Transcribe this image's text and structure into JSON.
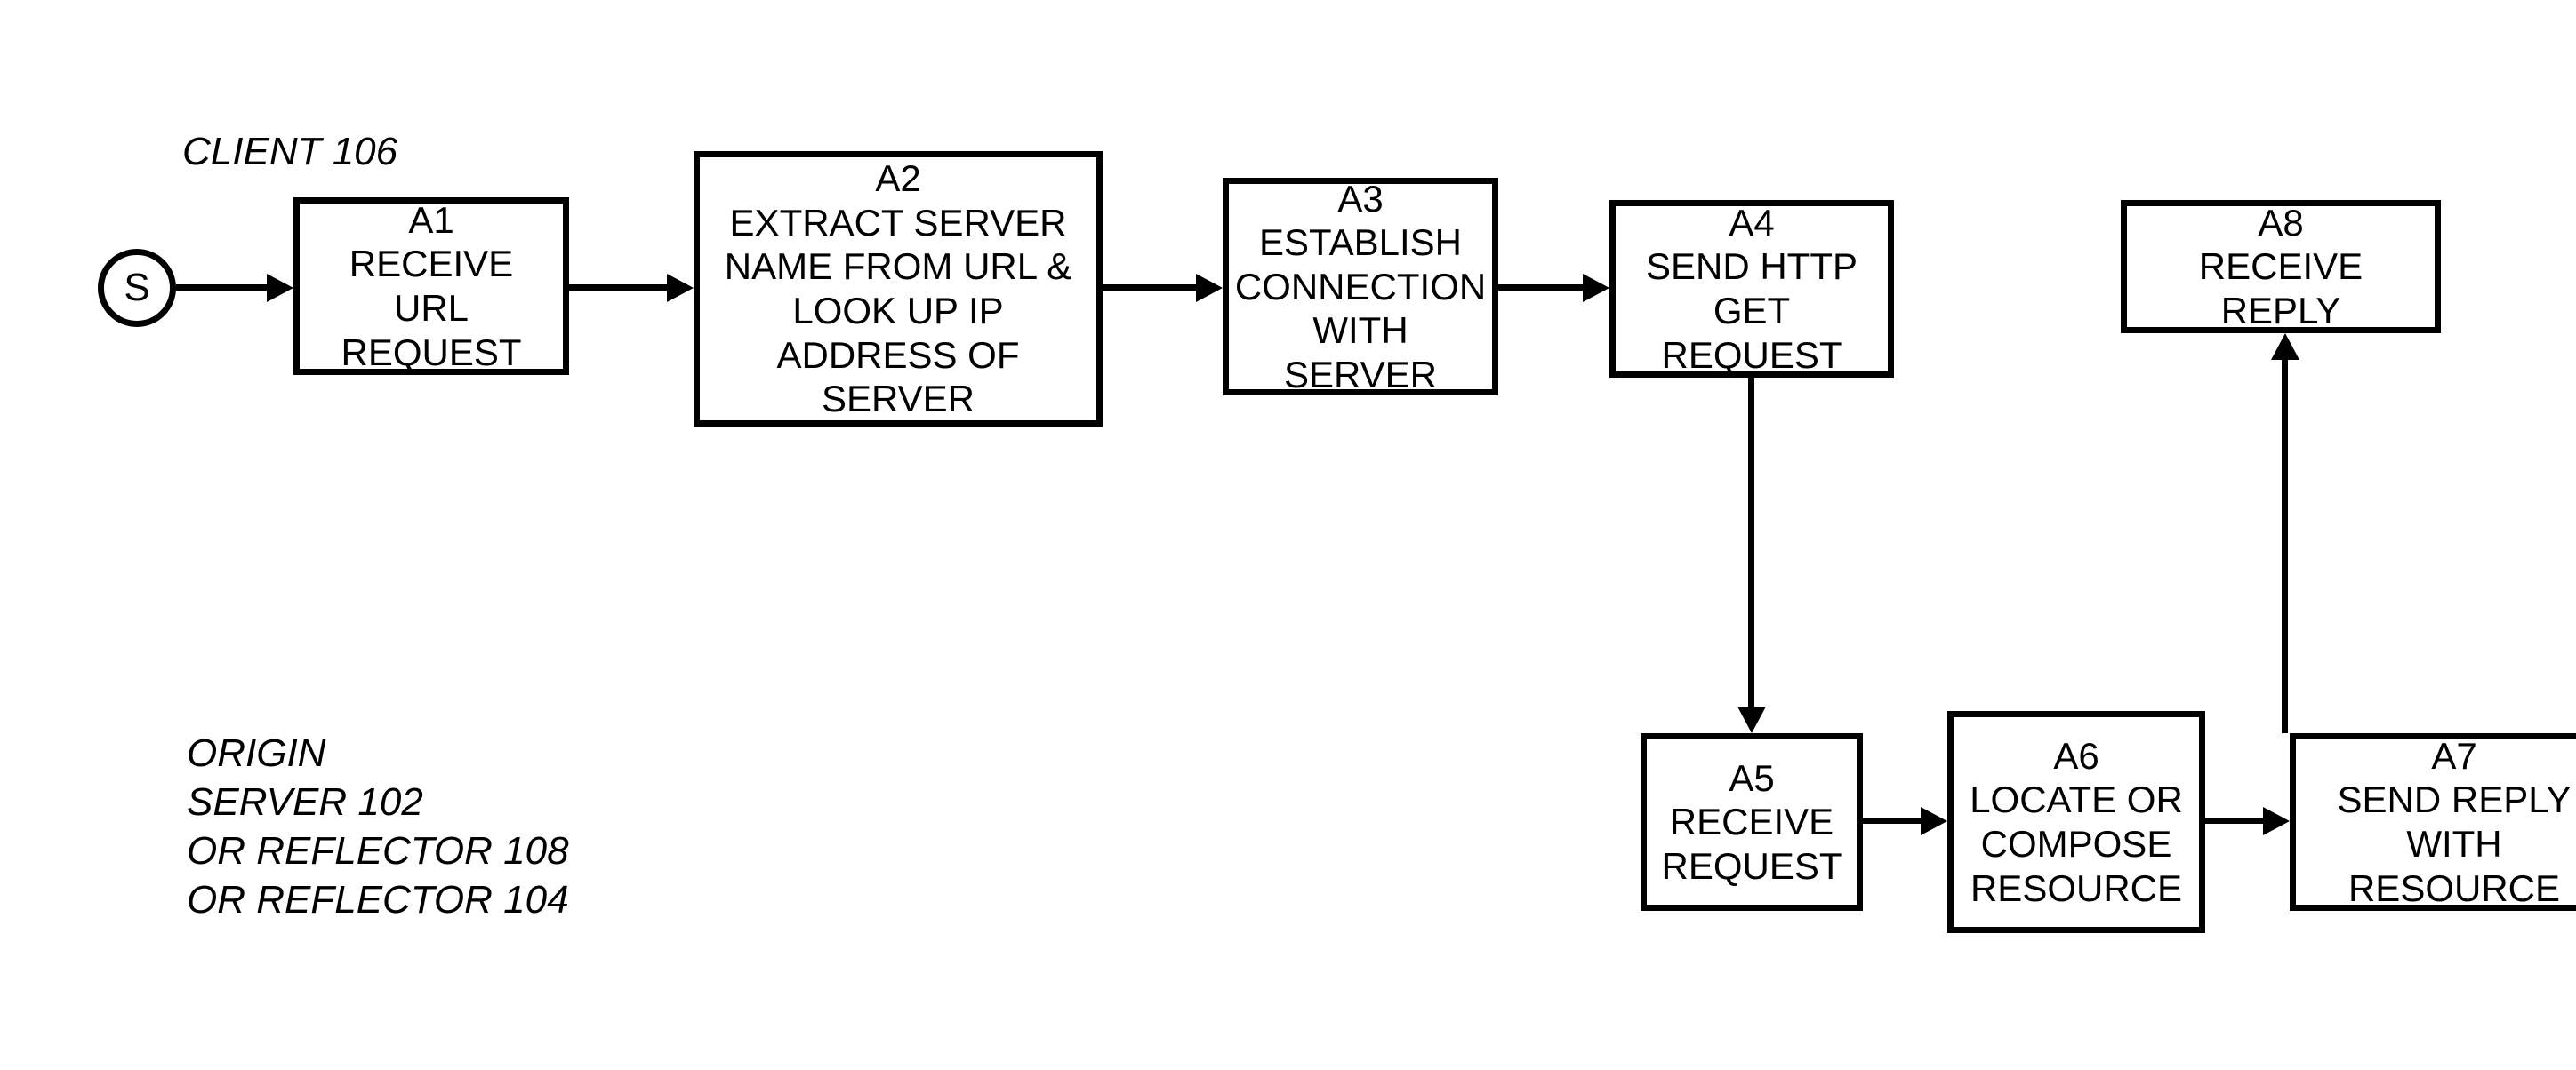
{
  "labels": {
    "client": "CLIENT 106",
    "origin_line1": "ORIGIN",
    "origin_line2": "SERVER 102",
    "origin_line3": "OR REFLECTOR 108",
    "origin_line4": "OR REFLECTOR 104"
  },
  "start": "S",
  "boxes": {
    "a1_code": "A1",
    "a1_text": "RECEIVE URL REQUEST",
    "a2_code": "A2",
    "a2_text": "EXTRACT SERVER NAME FROM URL & LOOK UP IP ADDRESS OF SERVER",
    "a3_code": "A3",
    "a3_text": "ESTABLISH CONNECTION WITH SERVER",
    "a4_code": "A4",
    "a4_text": "SEND HTTP GET REQUEST",
    "a5_code": "A5",
    "a5_text": "RECEIVE REQUEST",
    "a6_code": "A6",
    "a6_text": "LOCATE OR COMPOSE RESOURCE",
    "a7_code": "A7",
    "a7_text": "SEND REPLY WITH RESOURCE",
    "a8_code": "A8",
    "a8_text": "RECEIVE REPLY"
  }
}
